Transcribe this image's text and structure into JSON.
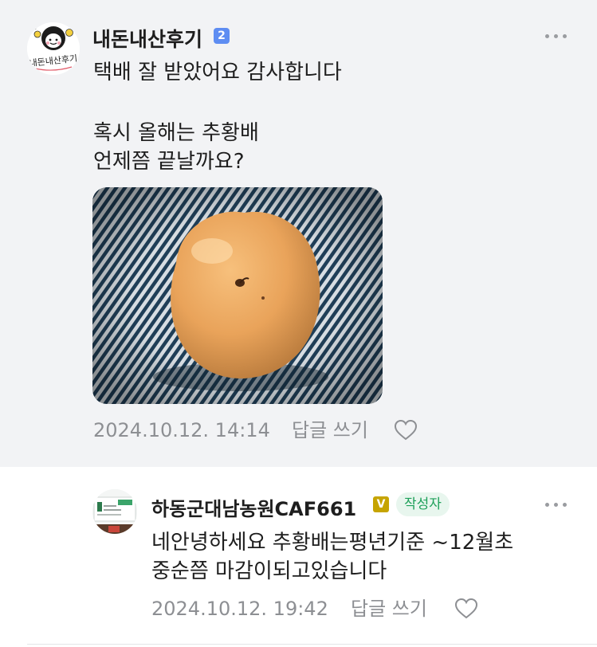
{
  "comment": {
    "nickname": "내돈내산후기",
    "level_badge": "2",
    "line1": "택배 잘 받았어요 감사합니다",
    "line2": "혹시 올해는 추황배",
    "line3": "언제쯤 끝날까요?",
    "avatar_text": "내돈내산후기",
    "timestamp": "2024.10.12. 14:14",
    "reply_label": "답글 쓰기"
  },
  "reply": {
    "nickname": "하동군대남농원CAF661",
    "v_badge": "V",
    "author_tag": "작성자",
    "line1": "네안녕하세요 추황배는평년기준 ~12월초",
    "line2": "중순쯤 마감이되고있습니다",
    "timestamp": "2024.10.12. 19:42",
    "reply_label": "답글 쓰기"
  },
  "icons": {
    "more": "more-horizontal-icon",
    "like": "heart-outline-icon"
  },
  "colors": {
    "comment_bg": "#f2f3f5",
    "author_tag_text": "#1ea05a",
    "author_tag_bg": "#e8f6ee",
    "level_badge": "#5e8df2",
    "v_badge": "#c6a400",
    "meta_text": "#8d8f93"
  }
}
